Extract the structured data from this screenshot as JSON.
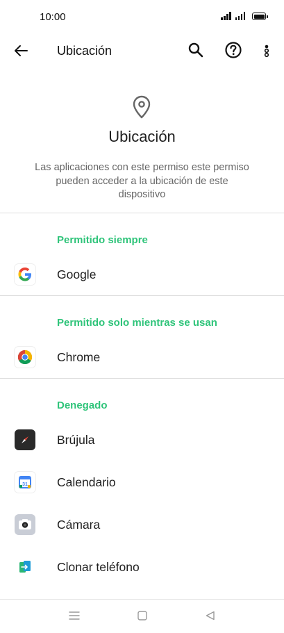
{
  "status_bar": {
    "time": "10:00"
  },
  "app_bar": {
    "title": "Ubicación"
  },
  "hero": {
    "title": "Ubicación",
    "description": "Las aplicaciones con este permiso este permiso pueden acceder a la ubicación de este dispositivo"
  },
  "sections": {
    "always": {
      "header": "Permitido siempre",
      "apps": [
        {
          "name": "Google",
          "icon": "google-icon"
        }
      ]
    },
    "while_in_use": {
      "header": "Permitido solo mientras se usan",
      "apps": [
        {
          "name": "Chrome",
          "icon": "chrome-icon"
        }
      ]
    },
    "denied": {
      "header": "Denegado",
      "apps": [
        {
          "name": "Brújula",
          "icon": "compass-icon"
        },
        {
          "name": "Calendario",
          "icon": "calendar-icon"
        },
        {
          "name": "Cámara",
          "icon": "camera-icon"
        },
        {
          "name": "Clonar teléfono",
          "icon": "clone-phone-icon"
        }
      ]
    }
  },
  "calendar_icon_day": "31",
  "colors": {
    "accent_green": "#2fc47a",
    "text": "#1f1f1f",
    "secondary_text": "#666666"
  }
}
